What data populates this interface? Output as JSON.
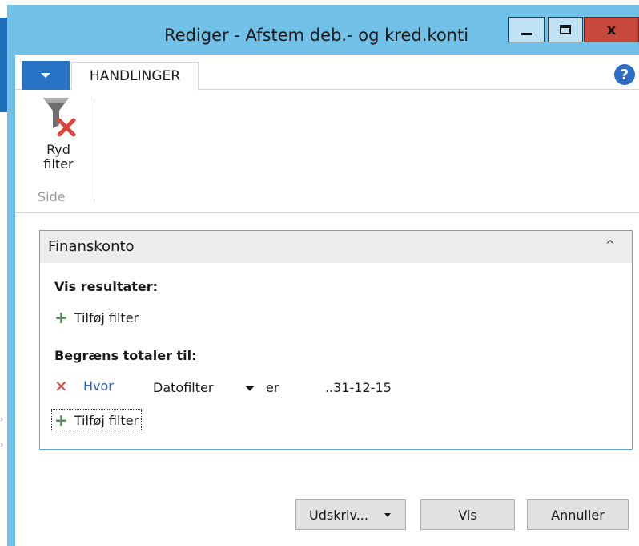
{
  "window": {
    "title": "Rediger - Afstem deb.- og kred.konti",
    "close_glyph": "x"
  },
  "ribbon": {
    "tab_label": "HANDLINGER",
    "help_glyph": "?",
    "clear_filter_label_1": "Ryd",
    "clear_filter_label_2": "filter",
    "group_label": "Side"
  },
  "panel": {
    "title": "Finanskonto",
    "collapse_glyph": "^",
    "show_results_label": "Vis resultater:",
    "add_filter_label": "Tilføj filter",
    "limit_totals_label": "Begræns totaler til:",
    "filter_row": {
      "where": "Hvor",
      "field": "Datofilter",
      "operator": "er",
      "value": "..31-12-15"
    },
    "add_filter_label_2": "Tilføj filter"
  },
  "buttons": {
    "print": "Udskriv...",
    "show": "Vis",
    "cancel": "Annuller"
  },
  "colors": {
    "title_bar": "#71c1e8",
    "close": "#c9483c",
    "accent": "#2872c6",
    "panel_border": "#5aa9d9",
    "remove_red": "#d2453a",
    "add_green": "#4d8f53",
    "link": "#2a5ec2"
  }
}
